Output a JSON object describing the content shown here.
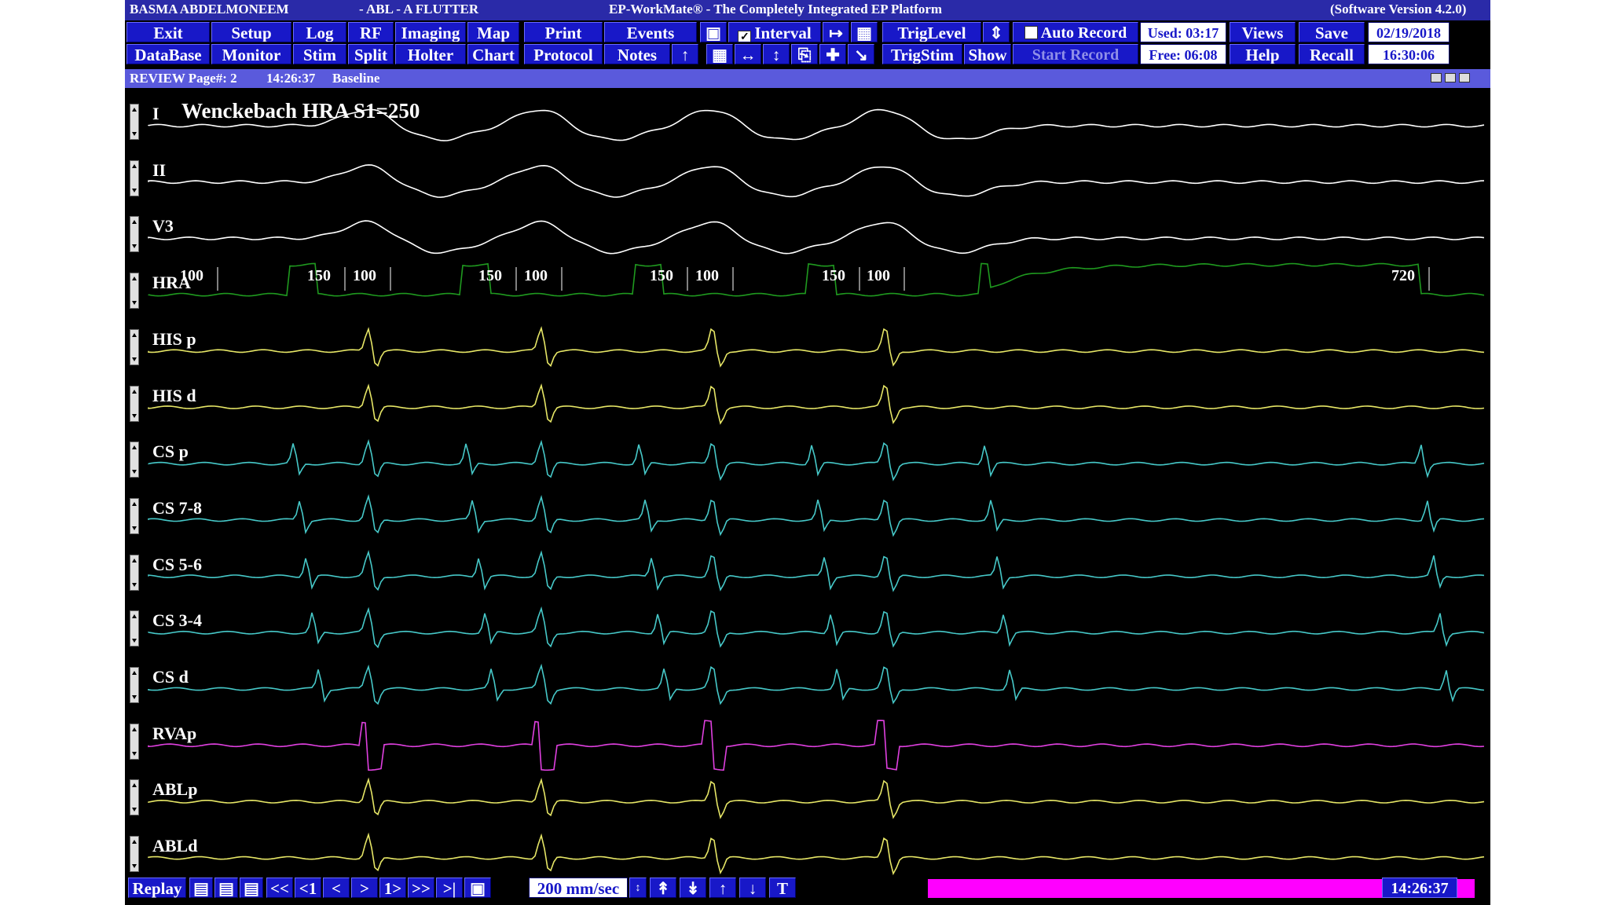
{
  "titlebar": {
    "patient": "BASMA ABDELMONEEM",
    "study": "-  ABL - A FLUTTER",
    "app": "EP-WorkMate®  -  The Completely Integrated EP Platform",
    "version": "(Software Version 4.2.0)"
  },
  "toolbar": {
    "exit": "Exit",
    "setup": "Setup",
    "log": "Log",
    "rf": "RF",
    "imaging": "Imaging",
    "map": "Map",
    "print": "Print",
    "events": "Events",
    "interval": "Interval",
    "triglevel": "TrigLevel",
    "auto_record": "Auto Record",
    "used": "Used: 03:17",
    "views": "Views",
    "save": "Save",
    "date": "02/19/2018",
    "database": "DataBase",
    "monitor": "Monitor",
    "stim": "Stim",
    "split": "Split",
    "holter": "Holter",
    "chart": "Chart",
    "protocol": "Protocol",
    "notes": "Notes",
    "trigstim": "TrigStim",
    "show": "Show",
    "start_record": "Start Record",
    "free": "Free: 06:08",
    "help": "Help",
    "recall": "Recall",
    "time": "16:30:06"
  },
  "review": {
    "page": "REVIEW Page#: 2",
    "time": "14:26:37",
    "label": "Baseline"
  },
  "annotation": "Wenckebach HRA S1=250",
  "channels": [
    {
      "label": "I",
      "color": "#ffffff"
    },
    {
      "label": "II",
      "color": "#ffffff"
    },
    {
      "label": "V3",
      "color": "#ffffff"
    },
    {
      "label": "HRA",
      "color": "#1f9a1f"
    },
    {
      "label": "HIS p",
      "color": "#e6e666"
    },
    {
      "label": "HIS d",
      "color": "#e6e666"
    },
    {
      "label": "CS p",
      "color": "#46c8c8"
    },
    {
      "label": "CS 7-8",
      "color": "#46c8c8"
    },
    {
      "label": "CS 5-6",
      "color": "#46c8c8"
    },
    {
      "label": "CS 3-4",
      "color": "#46c8c8"
    },
    {
      "label": "CS d",
      "color": "#46c8c8"
    },
    {
      "label": "RVAp",
      "color": "#e040e0"
    },
    {
      "label": "ABLp",
      "color": "#e6e666"
    },
    {
      "label": "ABLd",
      "color": "#e6e666"
    }
  ],
  "intervals": [
    {
      "value": "100",
      "t_ms": 0
    },
    {
      "value": "150",
      "t_ms": 0
    },
    {
      "value": "100",
      "t_ms": 0
    },
    {
      "value": "150",
      "t_ms": 0
    },
    {
      "value": "100",
      "t_ms": 0
    },
    {
      "value": "150",
      "t_ms": 0
    },
    {
      "value": "100",
      "t_ms": 0
    },
    {
      "value": "150",
      "t_ms": 0
    },
    {
      "value": "100",
      "t_ms": 0
    },
    {
      "value": "720",
      "t_ms": 0
    }
  ],
  "bottombar": {
    "replay": "Replay",
    "speed": "200 mm/sec",
    "clock": "14:26:37",
    "nav": [
      "<<",
      "<1",
      "<",
      ">",
      "1>",
      ">>",
      ">|"
    ]
  }
}
